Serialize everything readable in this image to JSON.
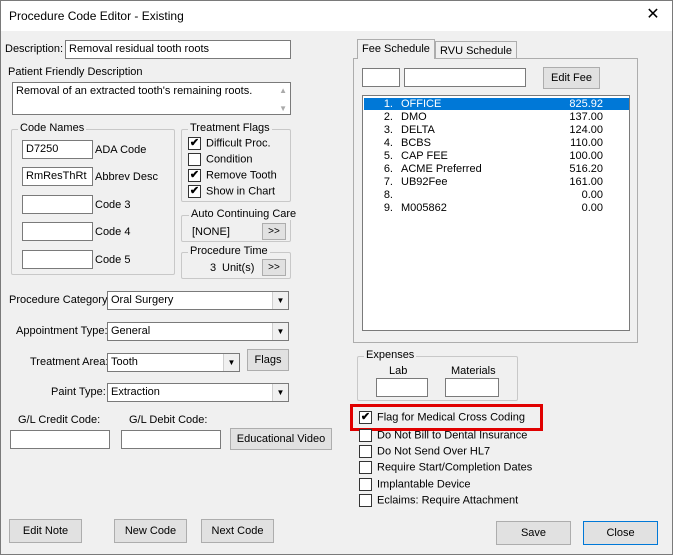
{
  "window": {
    "title": "Procedure Code Editor - Existing",
    "close_glyph": "✕"
  },
  "description": {
    "label": "Description:",
    "value": "Removal residual tooth roots"
  },
  "patient_friendly": {
    "label": "Patient Friendly Description",
    "value": "Removal of an extracted tooth's remaining roots."
  },
  "code_names": {
    "title": "Code Names",
    "rows": [
      {
        "value": "D7250",
        "label": "ADA Code"
      },
      {
        "value": "RmResThRt",
        "label": "Abbrev Desc"
      },
      {
        "value": "",
        "label": "Code 3"
      },
      {
        "value": "",
        "label": "Code 4"
      },
      {
        "value": "",
        "label": "Code 5"
      }
    ]
  },
  "treatment_flags": {
    "title": "Treatment Flags",
    "items": [
      {
        "label": "Difficult Proc.",
        "checked": true
      },
      {
        "label": "Condition",
        "checked": false
      },
      {
        "label": "Remove Tooth",
        "checked": true
      },
      {
        "label": "Show in Chart",
        "checked": true
      }
    ]
  },
  "auto_continuing_care": {
    "title": "Auto Continuing Care",
    "value": "[NONE]",
    "button": ">>"
  },
  "procedure_time": {
    "title": "Procedure Time",
    "units": "3",
    "units_label": "Unit(s)",
    "button": ">>"
  },
  "procedure_category": {
    "label": "Procedure Category:",
    "value": "Oral Surgery"
  },
  "appointment_type": {
    "label": "Appointment Type:",
    "value": "General"
  },
  "treatment_area": {
    "label": "Treatment Area:",
    "value": "Tooth",
    "flags_button": "Flags"
  },
  "paint_type": {
    "label": "Paint Type:",
    "value": "Extraction"
  },
  "gl_credit": {
    "label": "G/L Credit Code:",
    "value": ""
  },
  "gl_debit": {
    "label": "G/L Debit Code:",
    "value": ""
  },
  "educational_video": "Educational Video",
  "tabs": [
    {
      "label": "Fee Schedule",
      "active": true
    },
    {
      "label": "RVU Schedule",
      "active": false
    }
  ],
  "fee_schedule": {
    "edit_fee_button": "Edit Fee",
    "input1": "",
    "input2": "",
    "rows": [
      {
        "num": "1.",
        "name": "OFFICE",
        "value": "825.92",
        "selected": true
      },
      {
        "num": "2.",
        "name": "DMO",
        "value": "137.00"
      },
      {
        "num": "3.",
        "name": "DELTA",
        "value": "124.00"
      },
      {
        "num": "4.",
        "name": "BCBS",
        "value": "110.00"
      },
      {
        "num": "5.",
        "name": "CAP FEE",
        "value": "100.00"
      },
      {
        "num": "6.",
        "name": "ACME Preferred",
        "value": "516.20"
      },
      {
        "num": "7.",
        "name": "UB92Fee",
        "value": "161.00"
      },
      {
        "num": "8.",
        "name": "",
        "value": "0.00"
      },
      {
        "num": "9.",
        "name": "M005862",
        "value": "0.00"
      }
    ]
  },
  "expenses": {
    "title": "Expenses",
    "lab_label": "Lab",
    "materials_label": "Materials",
    "lab_value": "",
    "materials_value": ""
  },
  "checkboxes": [
    {
      "label": "Flag for Medical Cross Coding",
      "checked": true
    },
    {
      "label": "Do Not Bill to Dental Insurance",
      "checked": false
    },
    {
      "label": "Do Not Send Over HL7",
      "checked": false
    },
    {
      "label": "Require Start/Completion Dates",
      "checked": false
    },
    {
      "label": "Implantable Device",
      "checked": false
    },
    {
      "label": "Eclaims: Require Attachment",
      "checked": false
    }
  ],
  "buttons": {
    "edit_note": "Edit Note",
    "new_code": "New Code",
    "next_code": "Next Code",
    "save": "Save",
    "close": "Close"
  },
  "colors": {
    "selection": "#0078d7",
    "highlight": "#e00000"
  }
}
